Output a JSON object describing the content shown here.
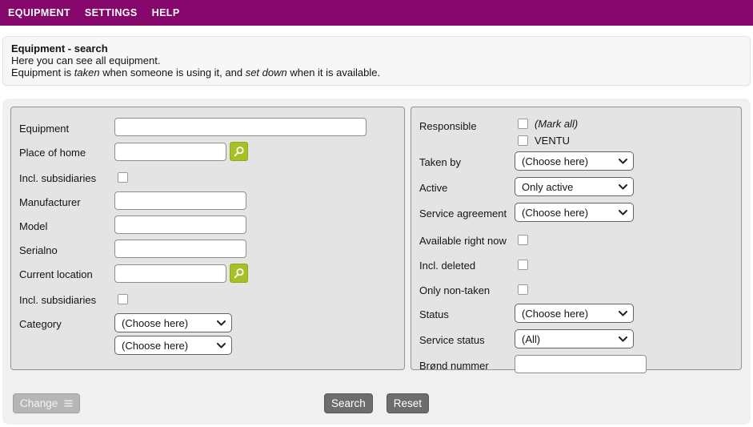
{
  "nav": {
    "equipment": "EQUIPMENT",
    "settings": "SETTINGS",
    "help": "HELP"
  },
  "header": {
    "title": "Equipment - search",
    "subtitle": "Here you can see all equipment.",
    "description": {
      "part1": "Equipment is ",
      "italic1": "taken",
      "part2": " when someone is using it, and ",
      "italic2": "set down",
      "part3": " when it is available."
    }
  },
  "left_panel": {
    "equipment_label": "Equipment",
    "place_of_home_label": "Place of home",
    "incl_subsidiaries_label": "Incl. subsidiaries",
    "manufacturer_label": "Manufacturer",
    "model_label": "Model",
    "serialno_label": "Serialno",
    "current_location_label": "Current location",
    "incl_subsidiaries2_label": "Incl. subsidiaries",
    "category_label": "Category",
    "category_select_value": "(Choose here)",
    "category_select2_value": "(Choose here)"
  },
  "right_panel": {
    "responsible_label": "Responsible",
    "mark_all_label": "(Mark all)",
    "ventu_label": "VENTU",
    "taken_by_label": "Taken by",
    "taken_by_value": "(Choose here)",
    "active_label": "Active",
    "active_value": "Only active",
    "service_agreement_label": "Service agreement",
    "service_agreement_value": "(Choose here)",
    "available_right_now_label": "Available right now",
    "incl_deleted_label": "Incl. deleted",
    "only_non_taken_label": "Only non-taken",
    "status_label": "Status",
    "status_value": "(Choose here)",
    "service_status_label": "Service status",
    "service_status_value": "(All)",
    "brond_nummer_label": "Brønd nummer"
  },
  "actions": {
    "change": "Change",
    "search": "Search",
    "reset": "Reset"
  },
  "colors": {
    "nav_bg": "#85076B",
    "search_button_green": "#A6C025",
    "action_button_gray": "#6D6D6D",
    "disabled_button_gray": "#B6B6B6"
  }
}
